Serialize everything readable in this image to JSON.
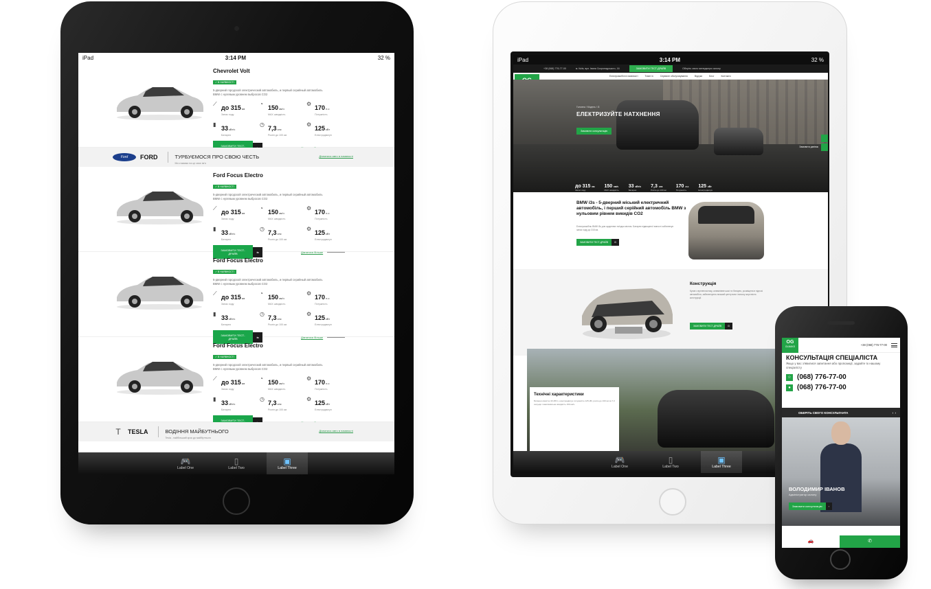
{
  "status": {
    "device": "iPad",
    "time": "3:14 PM",
    "battery": "32 %"
  },
  "left_listing": {
    "cars": [
      {
        "name": "Chevrolet Volt",
        "badge": "✓ В НАЯВНОСТІ",
        "desc": "5-дверний городской электрический автомобиль, и первый серийный автомобиль BMW с нулевым уровнем выбросов CO2",
        "range": "до 315",
        "range_unit": "км",
        "range_label": "Запас ходу",
        "speed": "150",
        "speed_unit": "км/ч",
        "speed_label": "MAX швидкість",
        "power": "170",
        "power_unit": "л.с",
        "power_label": "Потужність",
        "battery": "33",
        "battery_unit": "кВт/ч",
        "battery_label": "Батарея",
        "accel": "7,3",
        "accel_unit": "сек",
        "accel_label": "Розгін до 100 км",
        "motor": "125",
        "motor_unit": "кВт",
        "motor_label": "Електродвигун",
        "btn": "ЗАМОВИТИ ТЕСТ-ДРАЙВ",
        "more": "Дізнатися більше"
      },
      {
        "name": "Ford Focus Electro",
        "badge": "✓ В НАЯВНОСТІ",
        "desc": "5-дверний городской электрический автомобиль, и первый серийный автомобиль BMW с нулевым уровнем выбросов CO2",
        "range": "до 315",
        "range_unit": "км",
        "range_label": "Запас ходу",
        "speed": "150",
        "speed_unit": "км/ч",
        "speed_label": "MAX швидкість",
        "power": "170",
        "power_unit": "л.с",
        "power_label": "Потужність",
        "battery": "33",
        "battery_unit": "кВт/ч",
        "battery_label": "Батарея",
        "accel": "7,3",
        "accel_unit": "сек",
        "accel_label": "Розгін до 100 км",
        "motor": "125",
        "motor_unit": "кВт",
        "motor_label": "Електродвигун",
        "btn": "ЗАМОВИТИ ТЕСТ-ДРАЙВ",
        "more": "Дізнатися більше"
      },
      {
        "name": "Ford Focus Electro",
        "badge": "✓ В НАЯВНОСТІ",
        "desc": "5-дверний городской электрический автомобиль, и первый серийный автомобиль BMW с нулевым уровнем выбросов CO2",
        "range": "до 315",
        "range_unit": "км",
        "range_label": "Запас ходу",
        "speed": "150",
        "speed_unit": "км/ч",
        "speed_label": "MAX швидкість",
        "power": "170",
        "power_unit": "л.с",
        "power_label": "Потужність",
        "battery": "33",
        "battery_unit": "кВт/ч",
        "battery_label": "Батарея",
        "accel": "7,3",
        "accel_unit": "сек",
        "accel_label": "Розгін до 100 км",
        "motor": "125",
        "motor_unit": "кВт",
        "motor_label": "Електродвигун",
        "btn": "ЗАМОВИТИ ТЕСТ-ДРАЙВ",
        "more": "Дізнатися більше"
      },
      {
        "name": "Ford Focus Electro",
        "badge": "✓ В НАЯВНОСТІ",
        "desc": "5-дверний городской электрический автомобиль, и первый серийный автомобиль BMW с нулевым уровнем выбросов CO2",
        "range": "до 315",
        "range_unit": "км",
        "range_label": "Запас ходу",
        "speed": "150",
        "speed_unit": "км/ч",
        "speed_label": "MAX швидкість",
        "power": "170",
        "power_unit": "л.с",
        "power_label": "Потужність",
        "battery": "33",
        "battery_unit": "кВт/ч",
        "battery_label": "Батарея",
        "accel": "7,3",
        "accel_unit": "сек",
        "accel_label": "Розгін до 100 км",
        "motor": "125",
        "motor_unit": "кВт",
        "motor_label": "Електродвигун",
        "btn": "ЗАМОВИТИ ТЕСТ-ДРАЙВ",
        "more": "Дізнатися більше"
      }
    ],
    "ford_band": {
      "brand": "FORD",
      "oval": "Ford",
      "slogan": "ТУРБУЄМОСЯ ПРО СВОЮ ЧЕСТЬ",
      "sub": "Ми ставимо на це своє ім'я",
      "link": "Дізнатися авто в наявності"
    },
    "tesla_band": {
      "brand": "TESLA",
      "slogan": "ВОДІННЯ МАЙБУТНЬОГО",
      "sub": "Tesla - найбільший крок до майбутнього",
      "link": "Дізнатися авто в наявності"
    }
  },
  "tabbar": {
    "tabs": [
      "Label One",
      "Label Two",
      "Label Three"
    ],
    "active": 2
  },
  "right_site": {
    "topbar": {
      "phone": "+38 (068) 776-77-00",
      "address": "м. Київ, вул. Івана Скоропадського, 16",
      "cta": "ЗАМОВИТИ ТЕСТ-ДРАЙВ",
      "note": "Оберіть свого менеджера салону"
    },
    "nav": [
      "Електромобілі в наявності",
      "Trade in",
      "Сервісне обслуговування",
      "Відгуки",
      "Блог",
      "Контакти"
    ],
    "logo": {
      "mark": "OG",
      "name": "OLMAKS"
    },
    "hero": {
      "crumb": "Головна / Модель / i3",
      "title": "ЕЛЕКТРИЗУЙТЕ НАТХНЕННЯ",
      "btn": "Замовити консультацію",
      "call": "Замовити дзвінок",
      "specs": [
        {
          "v": "до 315",
          "u": "км",
          "l": "Запас ходу"
        },
        {
          "v": "150",
          "u": "км/ч",
          "l": "MAX швидкість"
        },
        {
          "v": "33",
          "u": "кВт/ч",
          "l": "Батарея"
        },
        {
          "v": "7,3",
          "u": "сек",
          "l": "Розгін до 100 км"
        },
        {
          "v": "170",
          "u": "л.с",
          "l": "Потужність"
        },
        {
          "v": "125",
          "u": "кВт",
          "l": "Електродвигун"
        }
      ]
    },
    "intro": {
      "title": "BMW i3s - 5-дверний міський електричний автомобіль, і перший серійний автомобіль BMW з нульовим рівнем викидів CO2",
      "text": "Електромобіль BMW i3s для щоденних поїздок містом. Батарея підвищеної ємності забезпечує запас ходу до 315 км.",
      "btn": "ЗАМОВИТИ ТЕСТ-ДРАЙВ",
      "btn2": "i3"
    },
    "construction": {
      "title": "Конструкція",
      "text": "Кузов з вуглепластику, алюмінієве шасі та батарея, розміщена в підлозі автомобіля, забезпечують низький центр ваги і високу жорсткість конструкції.",
      "btn": "ЗАМОВИТИ ТЕСТ-ДРАЙВ",
      "btn2": "i3"
    },
    "tech": {
      "title": "Технічні характеристики",
      "text": "Батарея ємністю 33 кВт/ч, електродвигун потужністю 125 кВт, розгін до 100 км за 7,3 секунди і максимальна швидкість 150 км/ч."
    }
  },
  "phone_site": {
    "logo": {
      "mark": "OG",
      "name": "OLMAKS"
    },
    "top_phone": "+38 (068) 776-77-00",
    "title": "КОНСУЛЬТАЦІЯ СПЕЦІАЛІСТА",
    "sub": "Якщо у вас з'явилися запитання або пропозиції, задайте їх нашому спеціалісту",
    "phones": [
      "(068) 776-77-00",
      "(068) 776-77-00"
    ],
    "consult_head": "ОБЕРІТЬ СВОГО КОНСУЛЬТАНТА",
    "name": "ВОЛОДИМИР ІВАНОВ",
    "role": "Адміністратор салону",
    "btn": "Замовити консультацію",
    "btn_arrow": "›"
  },
  "colors": {
    "accent": "#22a447",
    "dark": "#1c1c1c",
    "ford": "#1c3f8c"
  }
}
